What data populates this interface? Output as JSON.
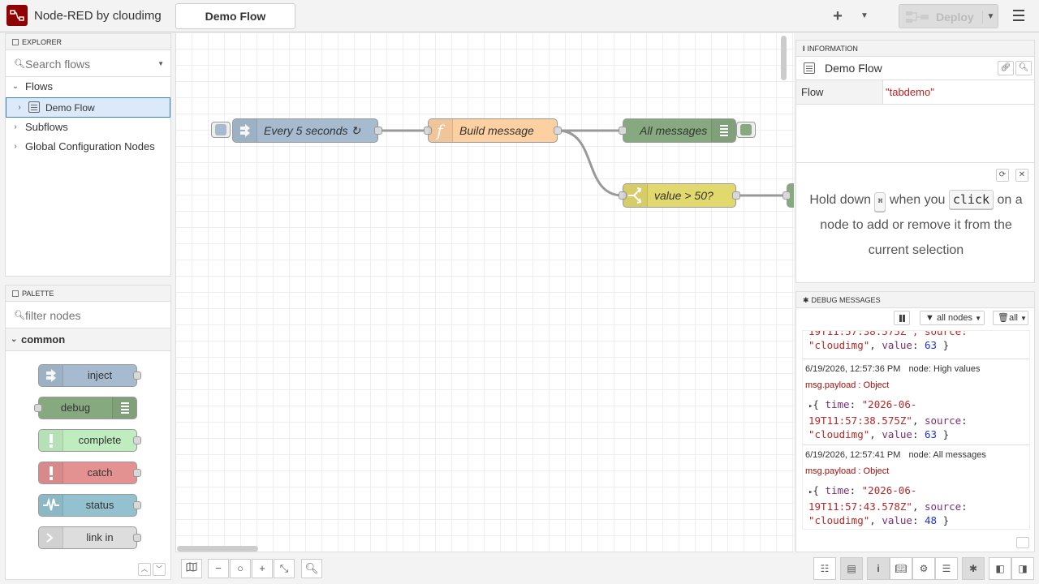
{
  "header": {
    "app_title": "Node-RED by cloudimg",
    "active_tab": "Demo Flow",
    "deploy_label": "Deploy"
  },
  "explorer": {
    "title": "EXPLORER",
    "search_placeholder": "Search flows",
    "tree": {
      "flows": "Flows",
      "demo_flow": "Demo Flow",
      "subflows": "Subflows",
      "global_config": "Global Configuration Nodes"
    }
  },
  "palette": {
    "title": "PALETTE",
    "filter_placeholder": "filter nodes",
    "category": "common",
    "nodes": [
      {
        "label": "inject",
        "color": "#a6bbcf"
      },
      {
        "label": "debug",
        "color": "#87a980"
      },
      {
        "label": "complete",
        "color": "#c0edc0"
      },
      {
        "label": "catch",
        "color": "#e49191"
      },
      {
        "label": "status",
        "color": "#94c1d0"
      },
      {
        "label": "link in",
        "color": "#dddddd"
      }
    ]
  },
  "workspace": {
    "nodes": {
      "inject": {
        "label": "Every 5 seconds ↻",
        "color": "#a6bbcf"
      },
      "function": {
        "label": "Build message",
        "color": "#fdd0a2"
      },
      "debug_all": {
        "label": "All messages",
        "color": "#87a980"
      },
      "switch": {
        "label": "value > 50?",
        "color": "#e2d96e"
      }
    }
  },
  "info": {
    "title": "INFORMATION",
    "flow_name": "Demo Flow",
    "prop_key": "Flow",
    "prop_value": "\"tabdemo\"",
    "tip": {
      "hold_down": "Hold down",
      "key": "⌘",
      "when_you": "when you",
      "click": "click",
      "rest": "on a node to add or remove it from the current selection"
    }
  },
  "debug": {
    "title": "DEBUG MESSAGES",
    "filter_label": "all nodes",
    "clear_label": "all",
    "partial": {
      "line1_frag": "19T11:57:38.575Z\", source:",
      "source": "\"cloudimg\"",
      "value": "63"
    },
    "messages": [
      {
        "time": "6/19/2026, 12:57:36 PM",
        "node": "node: High values",
        "type": "msg.payload : Object",
        "time_val_a": "\"2026-06-",
        "time_val_b": "19T11:57:38.575Z\"",
        "source": "\"cloudimg\"",
        "value": "63"
      },
      {
        "time": "6/19/2026, 12:57:41 PM",
        "node": "node: All messages",
        "type": "msg.payload : Object",
        "time_val_a": "\"2026-06-",
        "time_val_b": "19T11:57:43.578Z\"",
        "source": "\"cloudimg\"",
        "value": "48"
      }
    ]
  }
}
